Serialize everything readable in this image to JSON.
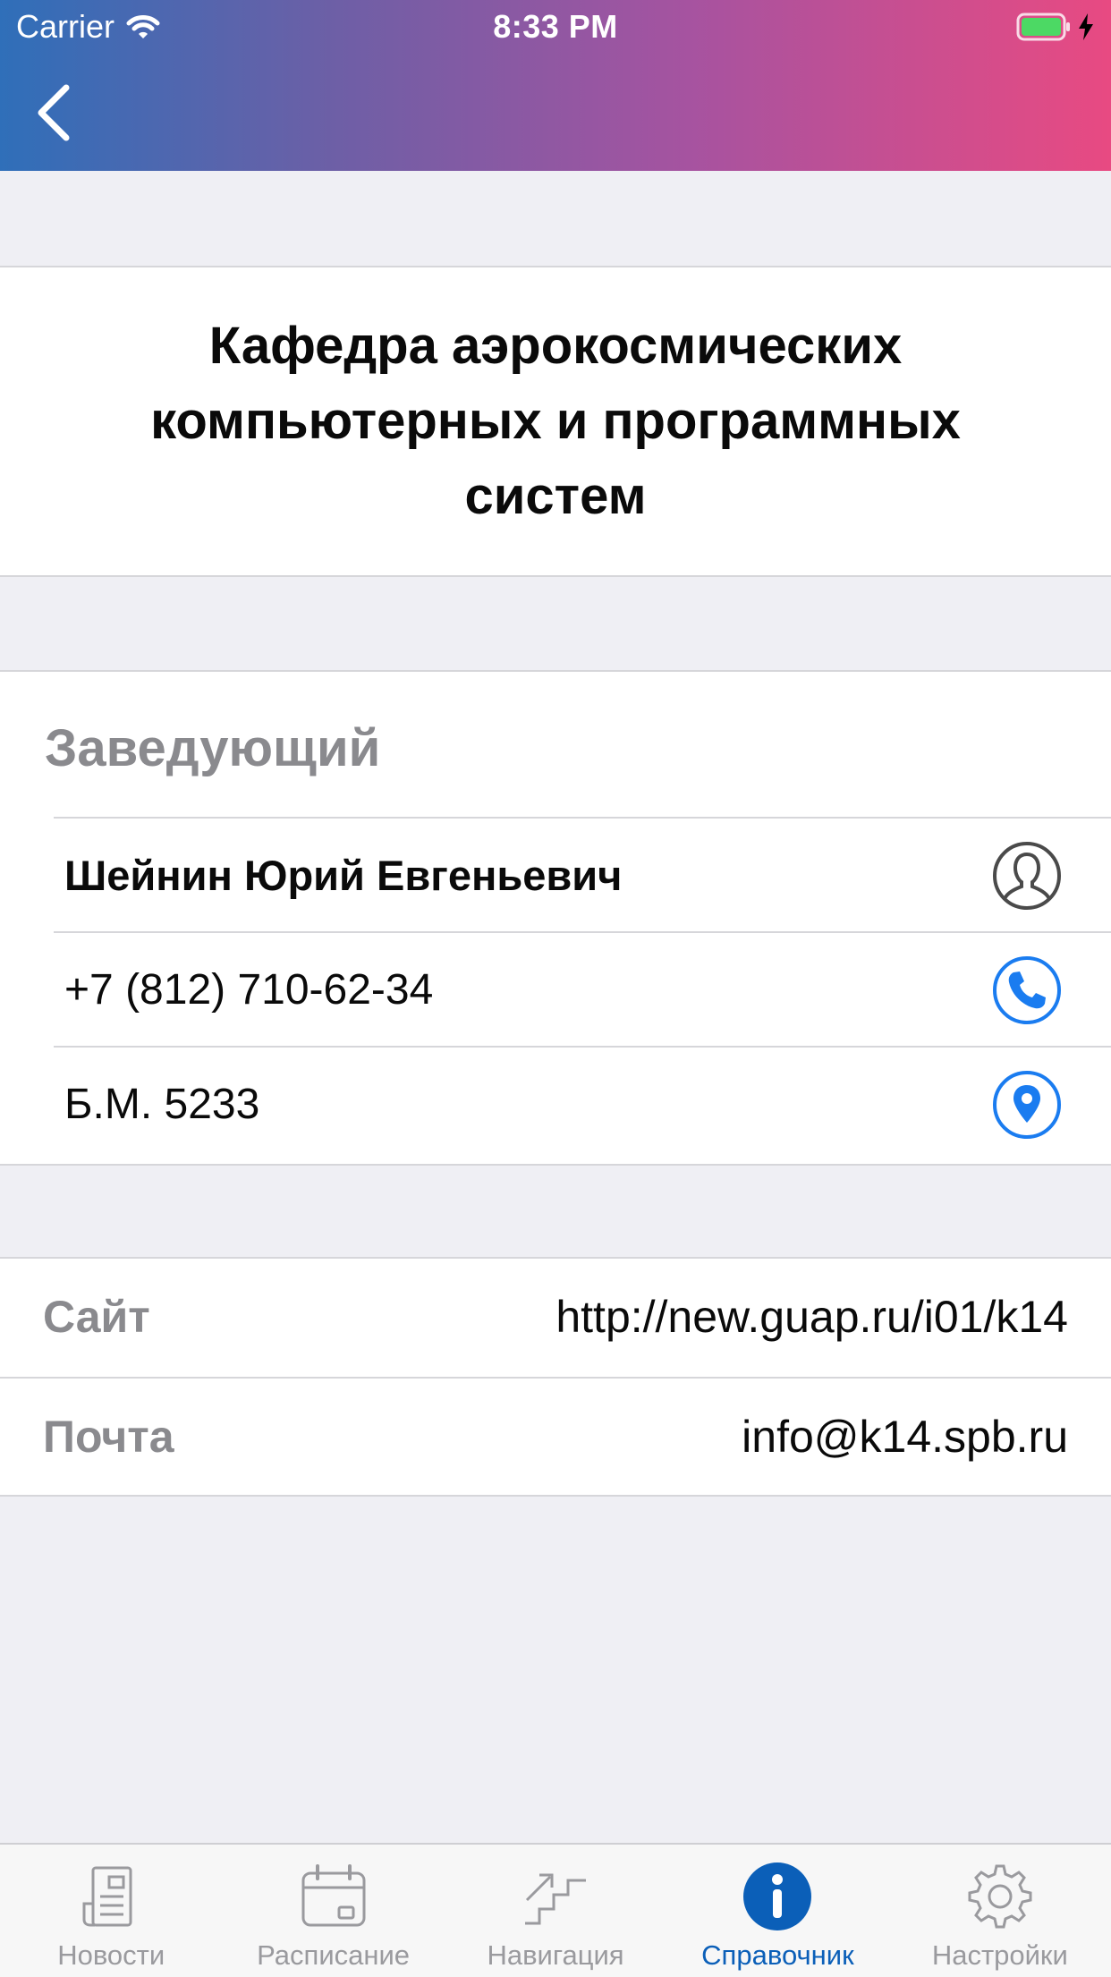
{
  "status_bar": {
    "carrier": "Carrier",
    "time": "8:33 PM"
  },
  "department": {
    "title": "Кафедра аэрокосмических компьютерных и программных систем"
  },
  "head": {
    "section_title": "Заведующий",
    "name": "Шейнин Юрий Евгеньевич",
    "phone": "+7 (812) 710-62-34",
    "room": "Б.М. 5233"
  },
  "links": {
    "site_label": "Сайт",
    "site_value": "http://new.guap.ru/i01/k14",
    "mail_label": "Почта",
    "mail_value": "info@k14.spb.ru"
  },
  "tabs": [
    {
      "label": "Новости",
      "icon": "newspaper-icon"
    },
    {
      "label": "Расписание",
      "icon": "calendar-icon"
    },
    {
      "label": "Навигация",
      "icon": "stairs-icon"
    },
    {
      "label": "Справочник",
      "icon": "info-icon",
      "active": true
    },
    {
      "label": "Настройки",
      "icon": "gear-icon"
    }
  ],
  "colors": {
    "accent_blue": "#0b5fb8",
    "icon_blue": "#1a7cf0",
    "header_gradient_start": "#2f6fb9",
    "header_gradient_end": "#e84a82",
    "battery_green": "#4cd964"
  }
}
